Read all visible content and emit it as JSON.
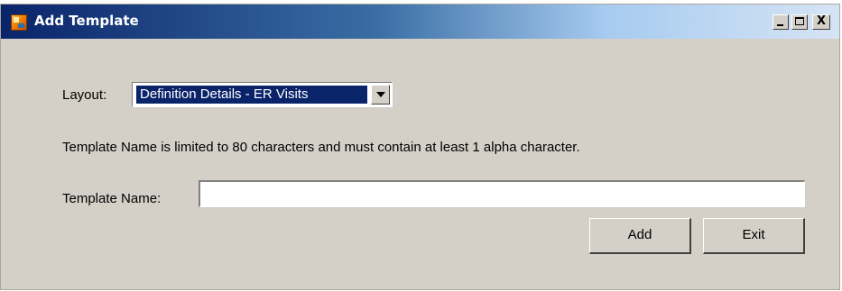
{
  "window": {
    "title": "Add Template",
    "icon": "app-icon",
    "controls": {
      "minimize": "minimize-icon",
      "maximize": "maximize-icon",
      "close_label": "X"
    }
  },
  "form": {
    "layout_label": "Layout:",
    "layout_selected": "Definition Details - ER Visits",
    "info_text": "Template Name is limited to 80 characters and must contain at least 1 alpha character.",
    "template_name_label": "Template Name:",
    "template_name_value": ""
  },
  "buttons": {
    "add_label": "Add",
    "exit_label": "Exit"
  },
  "colors": {
    "selection_bg": "#0a246a",
    "window_bg": "#d4d0c8",
    "title_start": "#0a246a",
    "title_end": "#d6e4f4"
  }
}
